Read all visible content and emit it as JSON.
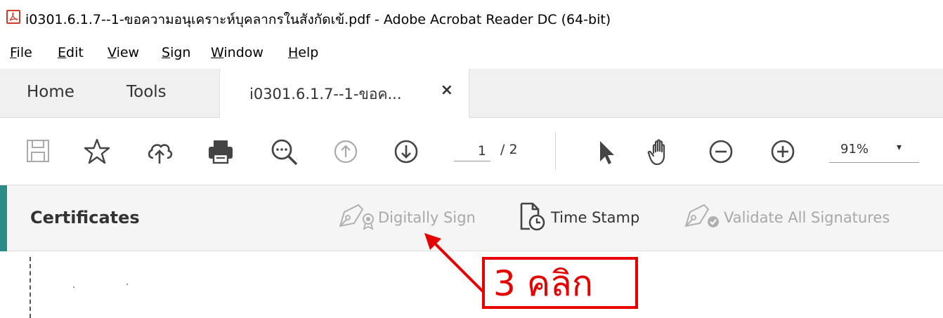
{
  "window": {
    "title": "i0301.6.1.7--1-ขอความอนุเคราะห์บุคลากรในสังกัดเข้.pdf - Adobe Acrobat Reader DC (64-bit)",
    "app_icon": "acrobat-icon"
  },
  "menu": {
    "items": [
      {
        "mnemonic": "F",
        "rest": "ile"
      },
      {
        "mnemonic": "E",
        "rest": "dit"
      },
      {
        "mnemonic": "V",
        "rest": "iew"
      },
      {
        "mnemonic": "S",
        "rest": "ign"
      },
      {
        "mnemonic": "W",
        "rest": "indow"
      },
      {
        "mnemonic": "H",
        "rest": "elp"
      }
    ]
  },
  "tabs": {
    "home": "Home",
    "tools": "Tools",
    "document": "i0301.6.1.7--1-ขอค...",
    "close": "×"
  },
  "toolbar": {
    "icons": [
      "save-icon",
      "star-icon",
      "cloud-upload-icon",
      "print-icon",
      "find-icon",
      "page-up-icon",
      "page-down-icon",
      "select-cursor-icon",
      "hand-icon",
      "zoom-out-icon",
      "zoom-in-icon"
    ],
    "current_page": "1",
    "page_total": "/ 2",
    "zoom": "91%",
    "zoom_caret": "▾"
  },
  "certificates": {
    "title": "Certificates",
    "digitally_sign": "Digitally Sign",
    "time_stamp": "Time Stamp",
    "validate_all": "Validate All Signatures"
  },
  "annotation": {
    "text": "3 คลิก"
  },
  "colors": {
    "accent": "#2a8c87",
    "annotation_red": "#e60000",
    "disabled_text": "#a8a8a8"
  }
}
